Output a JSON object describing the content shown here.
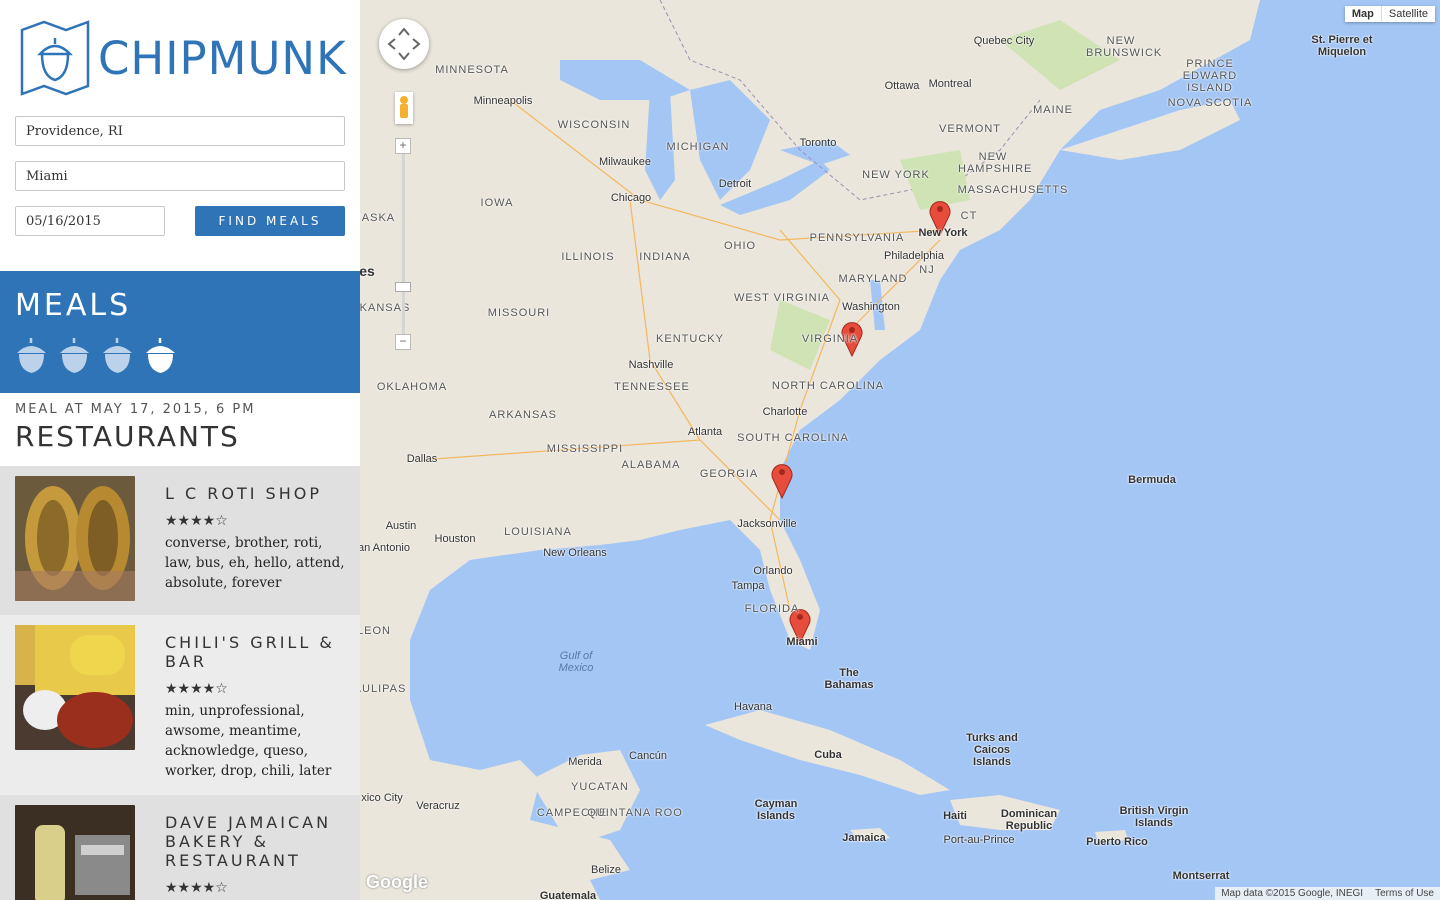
{
  "brand": {
    "name": "CHIPMUNK"
  },
  "search": {
    "origin": "Providence, RI",
    "destination": "Miami",
    "date": "05/16/2015",
    "find_label": "FIND MEALS"
  },
  "meals": {
    "title": "MEALS",
    "acorns": [
      {
        "icon": "acorn-icon",
        "selected": false
      },
      {
        "icon": "acorn-icon",
        "selected": false
      },
      {
        "icon": "acorn-icon",
        "selected": false
      },
      {
        "icon": "acorn-icon",
        "selected": true
      }
    ]
  },
  "meal": {
    "when": "MEAL AT MAY 17, 2015, 6 PM",
    "heading": "RESTAURANTS"
  },
  "restaurants": [
    {
      "name": "L C Roti Shop",
      "stars": "★★★★☆",
      "rating": 4,
      "keywords": "converse, brother, roti, law, bus, eh, hello, attend, absolute, forever"
    },
    {
      "name": "Chili's Grill & Bar",
      "stars": "★★★★☆",
      "rating": 4,
      "keywords": "min, unprofessional, awsome, meantime, acknowledge, queso, worker, drop, chili, later"
    },
    {
      "name": "Dave Jamaican Bakery & Restaurant",
      "stars": "★★★★☆",
      "rating": 4,
      "keywords": ""
    }
  ],
  "map": {
    "type_controls": [
      "Map",
      "Satellite"
    ],
    "google": "Google",
    "attribution": "Map data ©2015 Google, INEGI",
    "terms": "Terms of Use",
    "colors": {
      "water": "#a3c6f5",
      "land": "#eae6dc",
      "marker": "#e74c3c",
      "accent": "#2f74b7"
    },
    "labels": {
      "minnesota": "MINNESOTA",
      "minneapolis": "Minneapolis",
      "wisconsin": "WISCONSIN",
      "michigan": "MICHIGAN",
      "milwaukee": "Milwaukee",
      "chicago": "Chicago",
      "detroit": "Detroit",
      "iowa": "IOWA",
      "illinois": "ILLINOIS",
      "indiana": "INDIANA",
      "ohio": "OHIO",
      "pennsylvania": "PENNSYLVANIA",
      "newyork_state": "NEW YORK",
      "newyork": "New York",
      "philadelphia": "Philadelphia",
      "nj": "NJ",
      "maryland": "MARYLAND",
      "washington": "Washington",
      "westvirginia": "WEST VIRGINIA",
      "virginia": "VIRGINIA",
      "kentucky": "KENTUCKY",
      "missouri": "MISSOURI",
      "kansas": "KANSAS",
      "oklahoma": "OKLAHOMA",
      "arkansas": "ARKANSAS",
      "tennessee": "TENNESSEE",
      "nashville": "Nashville",
      "northcarolina": "NORTH CAROLINA",
      "charlotte": "Charlotte",
      "southcarolina": "SOUTH CAROLINA",
      "atlanta": "Atlanta",
      "mississippi": "MISSISSIPPI",
      "alabama": "ALABAMA",
      "georgia": "GEORGIA",
      "dallas": "Dallas",
      "louisiana": "LOUISIANA",
      "austin": "Austin",
      "houston": "Houston",
      "sanantonio": "an Antonio",
      "neworleans": "New Orleans",
      "jacksonville": "Jacksonville",
      "orlando": "Orlando",
      "tampa": "Tampa",
      "florida": "FLORIDA",
      "miami": "Miami",
      "gulf": "Gulf of Mexico",
      "thebahamas": "The Bahamas",
      "havana": "Havana",
      "cuba": "Cuba",
      "merida": "Merida",
      "cancun": "Cancún",
      "yucatan": "YUCATAN",
      "campeche": "CAMPECHE",
      "quintana": "QUINTANA ROO",
      "belize": "Belize",
      "guatemala": "Guatemala",
      "veracruz": "Veracruz",
      "tamaulipas": "AULIPAS",
      "leon": "LEON",
      "mexicocity": "xico City",
      "caymanislands": "Cayman Islands",
      "jamaica": "Jamaica",
      "haiti": "Haiti",
      "portauprince": "Port-au-Prince",
      "dominican": "Dominican Republic",
      "puertorico": "Puerto Rico",
      "turkscaicos": "Turks and Caicos Islands",
      "bvi": "British Virgin Islands",
      "montserrat": "Montserrat",
      "bermuda": "Bermuda",
      "toronto": "Toronto",
      "ottawa": "Ottawa",
      "montreal": "Montreal",
      "quebeccity": "Quebec City",
      "vermont": "VERMONT",
      "newhampshire": "NEW HAMPSHIRE",
      "massachusetts": "MASSACHUSETTS",
      "ct": "CT",
      "maine": "MAINE",
      "newbrunswick": "NEW BRUNSWICK",
      "pei": "PRINCE EDWARD ISLAND",
      "novascotia": "NOVA SCOTIA",
      "stpierre": "St. Pierre et Miquelon",
      "raska": "RASKA",
      "es": "es"
    },
    "markers": [
      {
        "name": "New York"
      },
      {
        "name": "Virginia"
      },
      {
        "name": "Georgia coast"
      },
      {
        "name": "Miami"
      }
    ]
  }
}
